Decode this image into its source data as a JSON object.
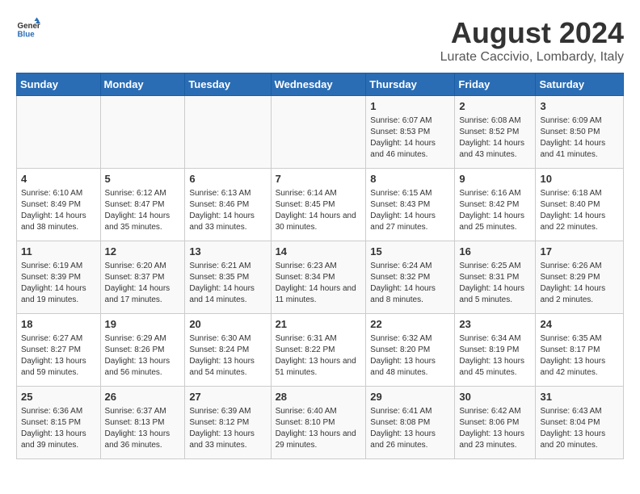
{
  "header": {
    "logo_general": "General",
    "logo_blue": "Blue",
    "title": "August 2024",
    "subtitle": "Lurate Caccivio, Lombardy, Italy"
  },
  "calendar": {
    "days_of_week": [
      "Sunday",
      "Monday",
      "Tuesday",
      "Wednesday",
      "Thursday",
      "Friday",
      "Saturday"
    ],
    "weeks": [
      [
        {
          "day": "",
          "info": ""
        },
        {
          "day": "",
          "info": ""
        },
        {
          "day": "",
          "info": ""
        },
        {
          "day": "",
          "info": ""
        },
        {
          "day": "1",
          "info": "Sunrise: 6:07 AM\nSunset: 8:53 PM\nDaylight: 14 hours and 46 minutes."
        },
        {
          "day": "2",
          "info": "Sunrise: 6:08 AM\nSunset: 8:52 PM\nDaylight: 14 hours and 43 minutes."
        },
        {
          "day": "3",
          "info": "Sunrise: 6:09 AM\nSunset: 8:50 PM\nDaylight: 14 hours and 41 minutes."
        }
      ],
      [
        {
          "day": "4",
          "info": "Sunrise: 6:10 AM\nSunset: 8:49 PM\nDaylight: 14 hours and 38 minutes."
        },
        {
          "day": "5",
          "info": "Sunrise: 6:12 AM\nSunset: 8:47 PM\nDaylight: 14 hours and 35 minutes."
        },
        {
          "day": "6",
          "info": "Sunrise: 6:13 AM\nSunset: 8:46 PM\nDaylight: 14 hours and 33 minutes."
        },
        {
          "day": "7",
          "info": "Sunrise: 6:14 AM\nSunset: 8:45 PM\nDaylight: 14 hours and 30 minutes."
        },
        {
          "day": "8",
          "info": "Sunrise: 6:15 AM\nSunset: 8:43 PM\nDaylight: 14 hours and 27 minutes."
        },
        {
          "day": "9",
          "info": "Sunrise: 6:16 AM\nSunset: 8:42 PM\nDaylight: 14 hours and 25 minutes."
        },
        {
          "day": "10",
          "info": "Sunrise: 6:18 AM\nSunset: 8:40 PM\nDaylight: 14 hours and 22 minutes."
        }
      ],
      [
        {
          "day": "11",
          "info": "Sunrise: 6:19 AM\nSunset: 8:39 PM\nDaylight: 14 hours and 19 minutes."
        },
        {
          "day": "12",
          "info": "Sunrise: 6:20 AM\nSunset: 8:37 PM\nDaylight: 14 hours and 17 minutes."
        },
        {
          "day": "13",
          "info": "Sunrise: 6:21 AM\nSunset: 8:35 PM\nDaylight: 14 hours and 14 minutes."
        },
        {
          "day": "14",
          "info": "Sunrise: 6:23 AM\nSunset: 8:34 PM\nDaylight: 14 hours and 11 minutes."
        },
        {
          "day": "15",
          "info": "Sunrise: 6:24 AM\nSunset: 8:32 PM\nDaylight: 14 hours and 8 minutes."
        },
        {
          "day": "16",
          "info": "Sunrise: 6:25 AM\nSunset: 8:31 PM\nDaylight: 14 hours and 5 minutes."
        },
        {
          "day": "17",
          "info": "Sunrise: 6:26 AM\nSunset: 8:29 PM\nDaylight: 14 hours and 2 minutes."
        }
      ],
      [
        {
          "day": "18",
          "info": "Sunrise: 6:27 AM\nSunset: 8:27 PM\nDaylight: 13 hours and 59 minutes."
        },
        {
          "day": "19",
          "info": "Sunrise: 6:29 AM\nSunset: 8:26 PM\nDaylight: 13 hours and 56 minutes."
        },
        {
          "day": "20",
          "info": "Sunrise: 6:30 AM\nSunset: 8:24 PM\nDaylight: 13 hours and 54 minutes."
        },
        {
          "day": "21",
          "info": "Sunrise: 6:31 AM\nSunset: 8:22 PM\nDaylight: 13 hours and 51 minutes."
        },
        {
          "day": "22",
          "info": "Sunrise: 6:32 AM\nSunset: 8:20 PM\nDaylight: 13 hours and 48 minutes."
        },
        {
          "day": "23",
          "info": "Sunrise: 6:34 AM\nSunset: 8:19 PM\nDaylight: 13 hours and 45 minutes."
        },
        {
          "day": "24",
          "info": "Sunrise: 6:35 AM\nSunset: 8:17 PM\nDaylight: 13 hours and 42 minutes."
        }
      ],
      [
        {
          "day": "25",
          "info": "Sunrise: 6:36 AM\nSunset: 8:15 PM\nDaylight: 13 hours and 39 minutes."
        },
        {
          "day": "26",
          "info": "Sunrise: 6:37 AM\nSunset: 8:13 PM\nDaylight: 13 hours and 36 minutes."
        },
        {
          "day": "27",
          "info": "Sunrise: 6:39 AM\nSunset: 8:12 PM\nDaylight: 13 hours and 33 minutes."
        },
        {
          "day": "28",
          "info": "Sunrise: 6:40 AM\nSunset: 8:10 PM\nDaylight: 13 hours and 29 minutes."
        },
        {
          "day": "29",
          "info": "Sunrise: 6:41 AM\nSunset: 8:08 PM\nDaylight: 13 hours and 26 minutes."
        },
        {
          "day": "30",
          "info": "Sunrise: 6:42 AM\nSunset: 8:06 PM\nDaylight: 13 hours and 23 minutes."
        },
        {
          "day": "31",
          "info": "Sunrise: 6:43 AM\nSunset: 8:04 PM\nDaylight: 13 hours and 20 minutes."
        }
      ]
    ]
  }
}
